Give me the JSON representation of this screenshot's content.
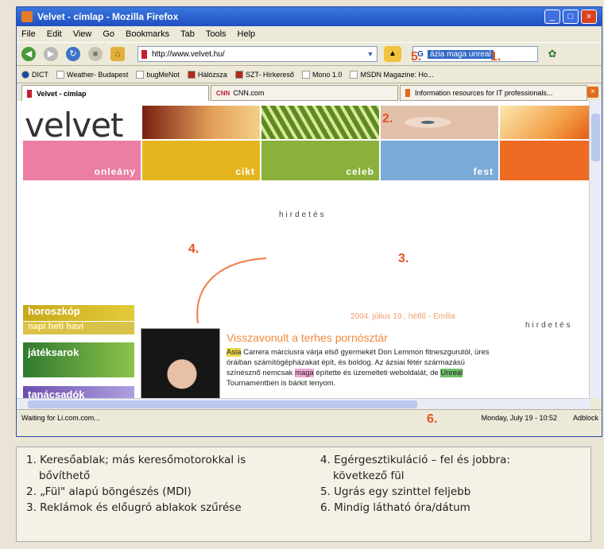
{
  "window": {
    "title": "Velvet - címlap - Mozilla Firefox",
    "controls": [
      "_",
      "□",
      "×"
    ]
  },
  "menu": [
    "File",
    "Edit",
    "View",
    "Go",
    "Bookmarks",
    "Tab",
    "Tools",
    "Help"
  ],
  "navbar": {
    "url": "http://www.velvet.hu/",
    "search_text": "ázia maga unreal"
  },
  "bookmarks": [
    "DICT",
    "Weather- Budapest",
    "bugMeNot",
    "Hálózsza",
    "SZT- Hírkereső",
    "Mono 1.0",
    "MSDN Magazine: Ho..."
  ],
  "tabs": {
    "active": "Velvet - címlap",
    "cnn": "CNN.com",
    "cnn_badge": "CNN",
    "it": "Information resources for IT professionals..."
  },
  "page": {
    "logo": "velvet",
    "tiles": [
      "onleány",
      "cikt",
      "celeb",
      "fest",
      ""
    ],
    "ad_label": "hirdetés",
    "side_buttons": [
      "horoszkóp",
      "napi  heti  havi",
      "játéksarok",
      "tanácsadók"
    ],
    "date_line": "2004. július 19., hétfő - Emília",
    "headline": "Visszavonult a terhes pornósztár",
    "article": {
      "asia": "Asia",
      "t1": " Carrera márciusra várja első gyermekét Don Lemmon fitneszgurutól, üres óráiban számítógépházakat épít, és boldog. Az ázsiai fétér származású színésznő nemcsak ",
      "maga": "maga",
      "t2": " építette és üzemelteti weboldalát, de ",
      "unreal": "Unreal",
      "t3": " Tournamentben is bárkit lenyom."
    }
  },
  "status": {
    "left": "Waiting for Li.com.com...",
    "clock": "Monday, July 19 - 10:52",
    "adblock": "Adblock"
  },
  "markers": [
    "1.",
    "2.",
    "3.",
    "4.",
    "5.",
    "6."
  ],
  "legend": {
    "items": [
      "1. Keresőablak; más keresőmotorokkal is",
      "bővíthető",
      "2. „Fül\" alapú böngészés (MDI)",
      "3. Reklámok és előugró ablakok szűrése",
      "4. Egérgesztikuláció – fel és jobbra:",
      "következő fül",
      "5. Ugrás egy szinttel feljebb",
      "6. Mindig látható óra/dátum"
    ]
  }
}
